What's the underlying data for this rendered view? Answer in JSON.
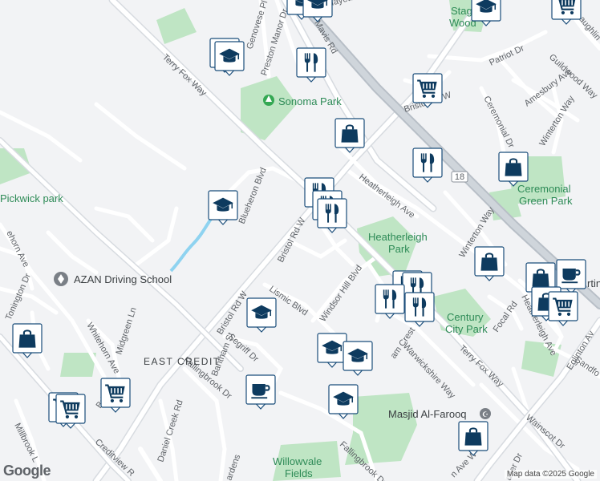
{
  "attribution": "Map data ©2025 Google",
  "logo": "Google",
  "colors": {
    "background": "#f2f3f5",
    "park": "#bfe5c4",
    "road": "#ffffff",
    "arterial": "#c8ced6",
    "water": "#8fd3f0",
    "marker_icon": "#0e3b5f"
  },
  "streets": {
    "terry_fox_way": "Terry Fox Way",
    "terry_fox_way_2": "Terry Fox Way",
    "mavis_rd": "Mavis Rd",
    "bristol_rd_w": "Bristol Rd W",
    "bristol_rd_w_2": "Bristol Rd W",
    "bristol_rd_w_3": "Bristol Rd W",
    "bristol_rd_w_4": "Bristol",
    "genovese_pl": "Genovese Pl",
    "preston_manor_dr": "Preston Manor Dr",
    "patriot_dr": "Patriot Dr",
    "guildwood_way": "Guildwood Way",
    "amesbury_ave": "Amesbury Ave",
    "ceremonial_dr": "Ceremonial Dr",
    "winterton_way": "Winterton Way",
    "winterton_way_2": "Winterton Way",
    "mclaughlin": "cLaughlin",
    "heatherleigh_ave": "Heatherleigh Ave",
    "heatherleigh_ave_2": "Heatherleigh Ave",
    "blueheron_blvd": "Blueheron Blvd",
    "lismic_blvd": "Lismic Blvd",
    "windsor_hill_blvd": "Windsor Hill Blvd",
    "warwickshire_way": "Warwickshire Way",
    "focal_rd": "Focal Rd",
    "eglinton_av": "Eglinton Av",
    "sandford": "Sandfo",
    "wainscot_dr": "Wainscot Dr",
    "whitehorn_ave": "Whitehorn Ave",
    "whitehorn_ave_2": "ehorn Ave",
    "tonington_dr": "Tonington Dr",
    "midgreen_ln": "Midgreen Ln",
    "segriff_dr": "Segriff Dr",
    "bantham_st": "Bantham St",
    "fallingbrook_dr": "Fallingbrook Dr",
    "fallingbrook_dr_2": "Fallingbrook Dr",
    "daniel_creek_rd": "Daniel Creek Rd",
    "creditview_rd": "Creditview R",
    "millbrook_ln": "Millbrook L",
    "crest": "am Crest",
    "lafayette": "Lafayette",
    "hwy_18": "18",
    "mavis_ave": "n Ave W",
    "fazer": "azer Dr",
    "gardens": "ardens"
  },
  "parks": {
    "sonoma_park": "Sonoma Park",
    "pickwick_park": "Pickwick park",
    "heatherleigh_park_1": "Heatherleigh",
    "heatherleigh_park_2": "Park",
    "century_city_park_1": "Century",
    "century_city_park_2": "City Park",
    "ceremonial_green_park_1": "Ceremonial",
    "ceremonial_green_park_2": "Green Park",
    "willowvale_1": "Willowvale",
    "willowvale_2": "Fields",
    "stag_wood_1": "Stag",
    "stag_wood_2": "Wood"
  },
  "areas": {
    "east_credit": "EAST CREDIT"
  },
  "pois": {
    "azan": "AZAN Driving School",
    "masjid": "Masjid Al-Farooq",
    "martin": "rtin"
  },
  "markers": {
    "school": "graduation-cap-icon",
    "restaurant": "fork-knife-icon",
    "shopping": "shopping-bag-icon",
    "grocery": "shopping-cart-icon",
    "cafe": "coffee-cup-icon"
  }
}
